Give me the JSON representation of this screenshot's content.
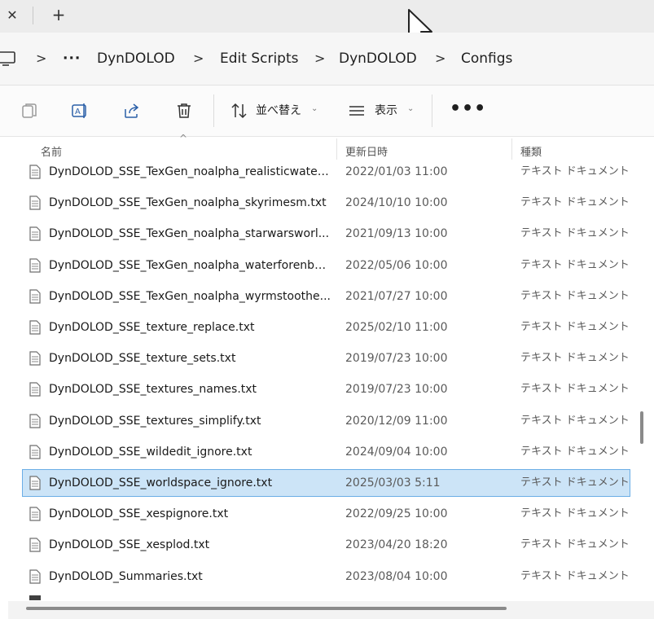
{
  "tabbar": {
    "close_glyph": "✕",
    "new_tab_glyph": "+"
  },
  "breadcrumb": {
    "ellipsis": "···",
    "items": [
      "DynDOLOD",
      "Edit Scripts",
      "DynDOLOD",
      "Configs"
    ],
    "separator": ">"
  },
  "toolbar": {
    "sort_label": "並べ替え",
    "view_label": "表示",
    "more_label": "•••",
    "icons": [
      "copy-icon",
      "rename-icon",
      "share-icon",
      "delete-icon",
      "sort-icon",
      "view-icon"
    ]
  },
  "columns": {
    "name": "名前",
    "date": "更新日時",
    "type": "種類"
  },
  "files": [
    {
      "name": "DynDOLOD_SSE_TexGen_noalpha_realisticwatert...",
      "date": "2022/01/03 11:00",
      "type": "テキスト ドキュメント"
    },
    {
      "name": "DynDOLOD_SSE_TexGen_noalpha_skyrimesm.txt",
      "date": "2024/10/10 10:00",
      "type": "テキスト ドキュメント"
    },
    {
      "name": "DynDOLOD_SSE_TexGen_noalpha_starwarsworl...",
      "date": "2021/09/13 10:00",
      "type": "テキスト ドキュメント"
    },
    {
      "name": "DynDOLOD_SSE_TexGen_noalpha_waterforenbe...",
      "date": "2022/05/06 10:00",
      "type": "テキスト ドキュメント"
    },
    {
      "name": "DynDOLOD_SSE_TexGen_noalpha_wyrmstoothe...",
      "date": "2021/07/27 10:00",
      "type": "テキスト ドキュメント"
    },
    {
      "name": "DynDOLOD_SSE_texture_replace.txt",
      "date": "2025/02/10 11:00",
      "type": "テキスト ドキュメント"
    },
    {
      "name": "DynDOLOD_SSE_texture_sets.txt",
      "date": "2019/07/23 10:00",
      "type": "テキスト ドキュメント"
    },
    {
      "name": "DynDOLOD_SSE_textures_names.txt",
      "date": "2019/07/23 10:00",
      "type": "テキスト ドキュメント"
    },
    {
      "name": "DynDOLOD_SSE_textures_simplify.txt",
      "date": "2020/12/09 11:00",
      "type": "テキスト ドキュメント"
    },
    {
      "name": "DynDOLOD_SSE_wildedit_ignore.txt",
      "date": "2024/09/04 10:00",
      "type": "テキスト ドキュメント"
    },
    {
      "name": "DynDOLOD_SSE_worldspace_ignore.txt",
      "date": "2025/03/03 5:11",
      "type": "テキスト ドキュメント",
      "selected": true
    },
    {
      "name": "DynDOLOD_SSE_xespignore.txt",
      "date": "2022/09/25 10:00",
      "type": "テキスト ドキュメント"
    },
    {
      "name": "DynDOLOD_SSE_xesplod.txt",
      "date": "2023/04/20 18:20",
      "type": "テキスト ドキュメント"
    },
    {
      "name": "DynDOLOD_Summaries.txt",
      "date": "2023/08/04 10:00",
      "type": "テキスト ドキュメント"
    }
  ],
  "colors": {
    "selection_bg": "#cce4f7",
    "selection_border": "#6baee6"
  }
}
